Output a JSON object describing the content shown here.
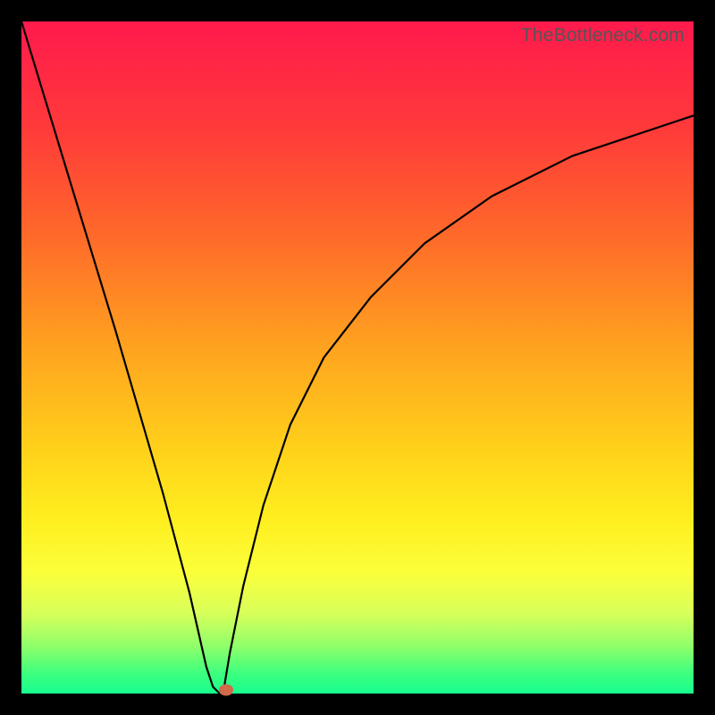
{
  "watermark": "TheBottleneck.com",
  "chart_data": {
    "type": "line",
    "title": "",
    "xlabel": "",
    "ylabel": "",
    "xlim": [
      0,
      100
    ],
    "ylim": [
      0,
      100
    ],
    "grid": false,
    "series": [
      {
        "name": "left-branch",
        "x": [
          0,
          7,
          14,
          21,
          25,
          27.5,
          28.5,
          29.5
        ],
        "values": [
          100,
          77,
          54,
          30,
          15,
          4,
          1,
          0
        ]
      },
      {
        "name": "right-branch",
        "x": [
          30,
          31,
          33,
          36,
          40,
          45,
          52,
          60,
          70,
          82,
          100
        ],
        "values": [
          0,
          6,
          16,
          28,
          40,
          50,
          59,
          67,
          74,
          80,
          86
        ]
      }
    ],
    "marker": {
      "x": 30.5,
      "y": 0.5,
      "color": "#cf6a4a"
    },
    "background_gradient": {
      "top": "#ff1a4d",
      "mid": "#ffd21a",
      "bottom": "#17ff8f"
    }
  }
}
